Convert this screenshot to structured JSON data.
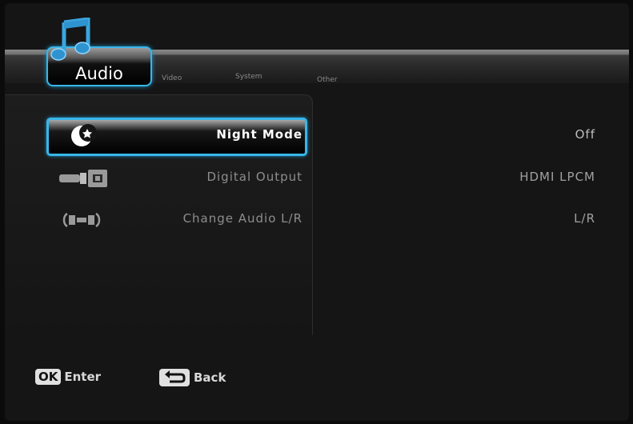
{
  "tabs": [
    {
      "label": "Audio",
      "active": true
    },
    {
      "label": "Video",
      "active": false
    },
    {
      "label": "System",
      "active": false
    },
    {
      "label": "Other",
      "active": false
    }
  ],
  "menu_items": [
    {
      "label": "Night Mode",
      "value": "Off",
      "icon": "night-mode-icon",
      "selected": true
    },
    {
      "label": "Digital Output",
      "value": "HDMI LPCM",
      "icon": "digital-output-icon",
      "selected": false
    },
    {
      "label": "Change Audio L/R",
      "value": "L/R",
      "icon": "speaker-lr-icon",
      "selected": false
    }
  ],
  "footer": {
    "ok_key": "OK",
    "ok_label": "Enter",
    "back_icon": "return-arrow-icon",
    "back_label": "Back"
  },
  "colors": {
    "accent": "#39b6e8",
    "background": "#151515"
  }
}
